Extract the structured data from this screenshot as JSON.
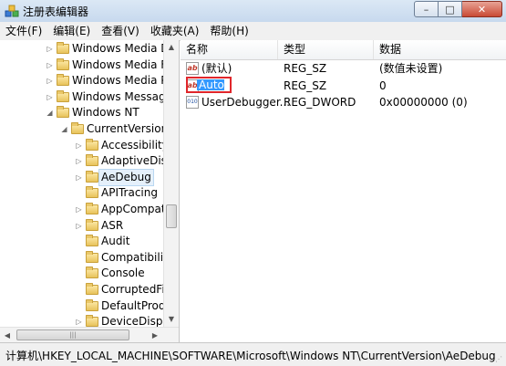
{
  "window": {
    "title": "注册表编辑器",
    "min_glyph": "–",
    "max_glyph": "□",
    "close_glyph": "✕",
    "app_icon": "regedit-icon"
  },
  "menu": [
    "文件(F)",
    "编辑(E)",
    "查看(V)",
    "收藏夹(A)",
    "帮助(H)"
  ],
  "tree": [
    {
      "label": "Windows Media De",
      "expander": "▷"
    },
    {
      "label": "Windows Media Fou",
      "expander": "▷"
    },
    {
      "label": "Windows Media Pla",
      "expander": "▷"
    },
    {
      "label": "Windows Messaging",
      "expander": "▷"
    },
    {
      "label": "Windows NT",
      "expander": "◢"
    },
    {
      "label": "CurrentVersion",
      "expander": "◢"
    },
    {
      "label": "Accessibility",
      "expander": "▷"
    },
    {
      "label": "AdaptiveDisp",
      "expander": "▷"
    },
    {
      "label": "AeDebug",
      "expander": "▷",
      "selected": true
    },
    {
      "label": "APITracing",
      "expander": ""
    },
    {
      "label": "AppCompatF",
      "expander": "▷"
    },
    {
      "label": "ASR",
      "expander": "▷"
    },
    {
      "label": "Audit",
      "expander": ""
    },
    {
      "label": "Compatibility",
      "expander": ""
    },
    {
      "label": "Console",
      "expander": ""
    },
    {
      "label": "CorruptedFile",
      "expander": ""
    },
    {
      "label": "DefaultProdu",
      "expander": ""
    },
    {
      "label": "DeviceDisplay",
      "expander": "▷"
    }
  ],
  "list": {
    "headers": {
      "name": "名称",
      "type": "类型",
      "data": "数据"
    },
    "rows": [
      {
        "name": "(默认)",
        "type": "REG_SZ",
        "data": "(数值未设置)",
        "icon": "ab"
      },
      {
        "name": "Auto",
        "type": "REG_SZ",
        "data": "0",
        "icon": "ab",
        "renaming": true
      },
      {
        "name": "UserDebugger...",
        "type": "REG_DWORD",
        "data": "0x00000000 (0)",
        "icon": "010"
      }
    ]
  },
  "statusbar": {
    "path": "计算机\\HKEY_LOCAL_MACHINE\\SOFTWARE\\Microsoft\\Windows NT\\CurrentVersion\\AeDebug"
  }
}
